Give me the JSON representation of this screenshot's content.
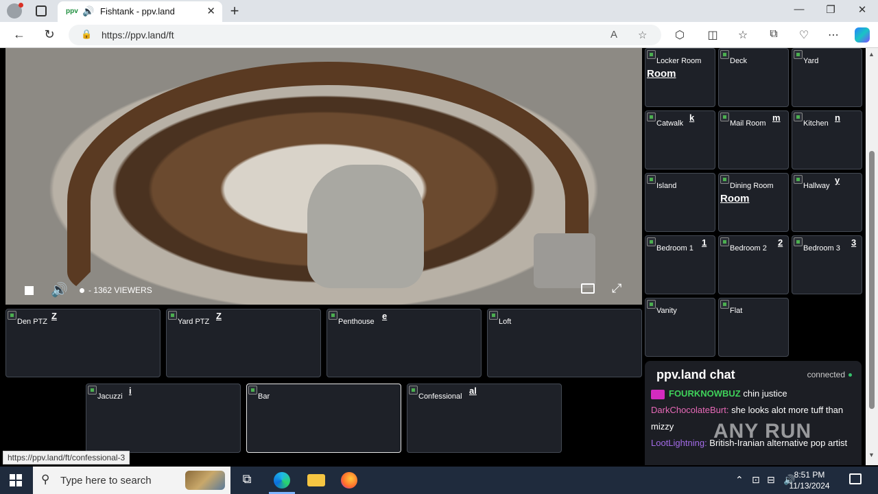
{
  "browser": {
    "tab_title": "Fishtank - ppv.land",
    "url": "https://ppv.land/ft",
    "status_url": "https://ppv.land/ft/confessional-3"
  },
  "player": {
    "viewers": "- 1362 VIEWERS"
  },
  "cams_bottom": [
    {
      "label": "Den PTZ",
      "alt": "Z"
    },
    {
      "label": "Yard PTZ",
      "alt": "Z"
    },
    {
      "label": "Penthouse",
      "alt": "e"
    },
    {
      "label": "Loft",
      "alt": ""
    },
    {
      "label": "Jacuzzi",
      "alt": "i"
    },
    {
      "label": "Bar",
      "alt": ""
    },
    {
      "label": "Confessional",
      "alt": "al"
    }
  ],
  "cams_side": [
    {
      "label": "Locker Room",
      "alt": "Room"
    },
    {
      "label": "Deck",
      "alt": ""
    },
    {
      "label": "Yard",
      "alt": ""
    },
    {
      "label": "Catwalk",
      "alt": "k"
    },
    {
      "label": "Mail Room",
      "alt": "m"
    },
    {
      "label": "Kitchen",
      "alt": "n"
    },
    {
      "label": "Island",
      "alt": ""
    },
    {
      "label": "Dining Room",
      "alt": "Room"
    },
    {
      "label": "Hallway",
      "alt": "y"
    },
    {
      "label": "Bedroom 1",
      "alt": "1"
    },
    {
      "label": "Bedroom 2",
      "alt": "2"
    },
    {
      "label": "Bedroom 3",
      "alt": "3"
    },
    {
      "label": "Vanity",
      "alt": ""
    },
    {
      "label": "Flat",
      "alt": ""
    }
  ],
  "chat": {
    "title": "ppv.land chat",
    "status": "connected",
    "messages": [
      {
        "user": "FOURKNOWBUZ",
        "text": "chin justice"
      },
      {
        "user": "DarkChocolateBurt:",
        "text": " she looks alot more tuff than mizzy"
      },
      {
        "user": "LootLightning:",
        "text": " British-Iranian alternative pop artist"
      }
    ]
  },
  "watermark": "ANY RUN",
  "taskbar": {
    "search_placeholder": "Type here to search",
    "time": "8:51 PM",
    "date": "11/13/2024"
  }
}
